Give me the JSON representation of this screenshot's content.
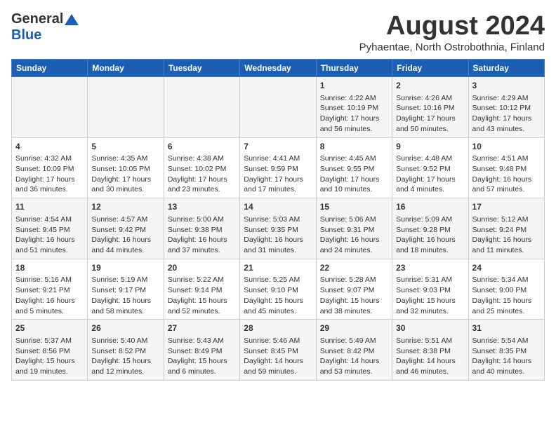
{
  "header": {
    "logo_general": "General",
    "logo_blue": "Blue",
    "month": "August 2024",
    "location": "Pyhaentae, North Ostrobothnia, Finland"
  },
  "days_of_week": [
    "Sunday",
    "Monday",
    "Tuesday",
    "Wednesday",
    "Thursday",
    "Friday",
    "Saturday"
  ],
  "weeks": [
    [
      {
        "day": "",
        "content": ""
      },
      {
        "day": "",
        "content": ""
      },
      {
        "day": "",
        "content": ""
      },
      {
        "day": "",
        "content": ""
      },
      {
        "day": "1",
        "content": "Sunrise: 4:22 AM\nSunset: 10:19 PM\nDaylight: 17 hours and 56 minutes."
      },
      {
        "day": "2",
        "content": "Sunrise: 4:26 AM\nSunset: 10:16 PM\nDaylight: 17 hours and 50 minutes."
      },
      {
        "day": "3",
        "content": "Sunrise: 4:29 AM\nSunset: 10:12 PM\nDaylight: 17 hours and 43 minutes."
      }
    ],
    [
      {
        "day": "4",
        "content": "Sunrise: 4:32 AM\nSunset: 10:09 PM\nDaylight: 17 hours and 36 minutes."
      },
      {
        "day": "5",
        "content": "Sunrise: 4:35 AM\nSunset: 10:05 PM\nDaylight: 17 hours and 30 minutes."
      },
      {
        "day": "6",
        "content": "Sunrise: 4:38 AM\nSunset: 10:02 PM\nDaylight: 17 hours and 23 minutes."
      },
      {
        "day": "7",
        "content": "Sunrise: 4:41 AM\nSunset: 9:59 PM\nDaylight: 17 hours and 17 minutes."
      },
      {
        "day": "8",
        "content": "Sunrise: 4:45 AM\nSunset: 9:55 PM\nDaylight: 17 hours and 10 minutes."
      },
      {
        "day": "9",
        "content": "Sunrise: 4:48 AM\nSunset: 9:52 PM\nDaylight: 17 hours and 4 minutes."
      },
      {
        "day": "10",
        "content": "Sunrise: 4:51 AM\nSunset: 9:48 PM\nDaylight: 16 hours and 57 minutes."
      }
    ],
    [
      {
        "day": "11",
        "content": "Sunrise: 4:54 AM\nSunset: 9:45 PM\nDaylight: 16 hours and 51 minutes."
      },
      {
        "day": "12",
        "content": "Sunrise: 4:57 AM\nSunset: 9:42 PM\nDaylight: 16 hours and 44 minutes."
      },
      {
        "day": "13",
        "content": "Sunrise: 5:00 AM\nSunset: 9:38 PM\nDaylight: 16 hours and 37 minutes."
      },
      {
        "day": "14",
        "content": "Sunrise: 5:03 AM\nSunset: 9:35 PM\nDaylight: 16 hours and 31 minutes."
      },
      {
        "day": "15",
        "content": "Sunrise: 5:06 AM\nSunset: 9:31 PM\nDaylight: 16 hours and 24 minutes."
      },
      {
        "day": "16",
        "content": "Sunrise: 5:09 AM\nSunset: 9:28 PM\nDaylight: 16 hours and 18 minutes."
      },
      {
        "day": "17",
        "content": "Sunrise: 5:12 AM\nSunset: 9:24 PM\nDaylight: 16 hours and 11 minutes."
      }
    ],
    [
      {
        "day": "18",
        "content": "Sunrise: 5:16 AM\nSunset: 9:21 PM\nDaylight: 16 hours and 5 minutes."
      },
      {
        "day": "19",
        "content": "Sunrise: 5:19 AM\nSunset: 9:17 PM\nDaylight: 15 hours and 58 minutes."
      },
      {
        "day": "20",
        "content": "Sunrise: 5:22 AM\nSunset: 9:14 PM\nDaylight: 15 hours and 52 minutes."
      },
      {
        "day": "21",
        "content": "Sunrise: 5:25 AM\nSunset: 9:10 PM\nDaylight: 15 hours and 45 minutes."
      },
      {
        "day": "22",
        "content": "Sunrise: 5:28 AM\nSunset: 9:07 PM\nDaylight: 15 hours and 38 minutes."
      },
      {
        "day": "23",
        "content": "Sunrise: 5:31 AM\nSunset: 9:03 PM\nDaylight: 15 hours and 32 minutes."
      },
      {
        "day": "24",
        "content": "Sunrise: 5:34 AM\nSunset: 9:00 PM\nDaylight: 15 hours and 25 minutes."
      }
    ],
    [
      {
        "day": "25",
        "content": "Sunrise: 5:37 AM\nSunset: 8:56 PM\nDaylight: 15 hours and 19 minutes."
      },
      {
        "day": "26",
        "content": "Sunrise: 5:40 AM\nSunset: 8:52 PM\nDaylight: 15 hours and 12 minutes."
      },
      {
        "day": "27",
        "content": "Sunrise: 5:43 AM\nSunset: 8:49 PM\nDaylight: 15 hours and 6 minutes."
      },
      {
        "day": "28",
        "content": "Sunrise: 5:46 AM\nSunset: 8:45 PM\nDaylight: 14 hours and 59 minutes."
      },
      {
        "day": "29",
        "content": "Sunrise: 5:49 AM\nSunset: 8:42 PM\nDaylight: 14 hours and 53 minutes."
      },
      {
        "day": "30",
        "content": "Sunrise: 5:51 AM\nSunset: 8:38 PM\nDaylight: 14 hours and 46 minutes."
      },
      {
        "day": "31",
        "content": "Sunrise: 5:54 AM\nSunset: 8:35 PM\nDaylight: 14 hours and 40 minutes."
      }
    ]
  ]
}
